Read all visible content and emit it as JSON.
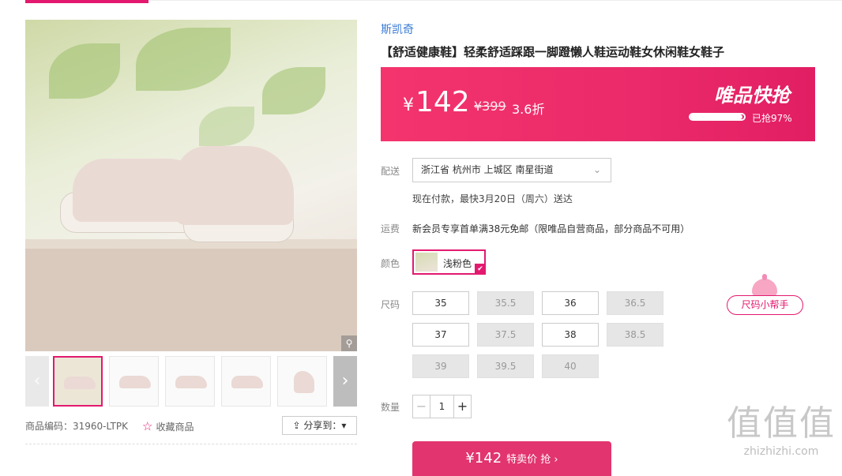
{
  "brand": "斯凯奇",
  "title": "【舒适健康鞋】轻柔舒适踩跟一脚蹬懒人鞋运动鞋女休闲鞋女鞋子",
  "price_banner": {
    "currency": "¥",
    "price": "142",
    "original_price": "¥399",
    "discount": "3.6折",
    "flash_label": "唯品快抢",
    "sold_progress": 0.97,
    "sold_text": "已抢97%"
  },
  "gallery": {
    "zoom_icon": "magnifier-icon",
    "prev_icon": "chevron-left-icon",
    "next_icon": "chevron-right-icon"
  },
  "meta": {
    "code_text": "商品编码：31960-LTPK",
    "favorite_icon": "star-outline-icon",
    "favorite_label": "收藏商品",
    "share_label": "分享到：▾"
  },
  "delivery": {
    "label": "配送",
    "address": "浙江省 杭州市 上城区 南星街道",
    "note": "现在付款，最快3月20日（周六）送达"
  },
  "shipping": {
    "label": "运费",
    "text": "新会员专享首单满38元免邮（限唯品自营商品，部分商品不可用）"
  },
  "color": {
    "label": "颜色",
    "selected": "浅粉色"
  },
  "sizes": {
    "label": "尺码",
    "helper_label": "尺码小帮手",
    "options": [
      {
        "value": "35",
        "available": true
      },
      {
        "value": "35.5",
        "available": false
      },
      {
        "value": "36",
        "available": true
      },
      {
        "value": "36.5",
        "available": false
      },
      {
        "value": "37",
        "available": true
      },
      {
        "value": "37.5",
        "available": false
      },
      {
        "value": "38",
        "available": true
      },
      {
        "value": "38.5",
        "available": false
      },
      {
        "value": "39",
        "available": false
      },
      {
        "value": "39.5",
        "available": false
      },
      {
        "value": "40",
        "available": false
      }
    ]
  },
  "quantity": {
    "label": "数量",
    "value": "1",
    "minus": "−",
    "plus": "+"
  },
  "buy_button": {
    "price": "¥142",
    "label": "特卖价 抢 ›"
  },
  "watermark": {
    "logo": "值值值",
    "site": "zhizhizhi.com"
  },
  "colors": {
    "accent": "#e3196f",
    "banner": "#ea2a6a",
    "brand_link": "#3a7bd5"
  }
}
